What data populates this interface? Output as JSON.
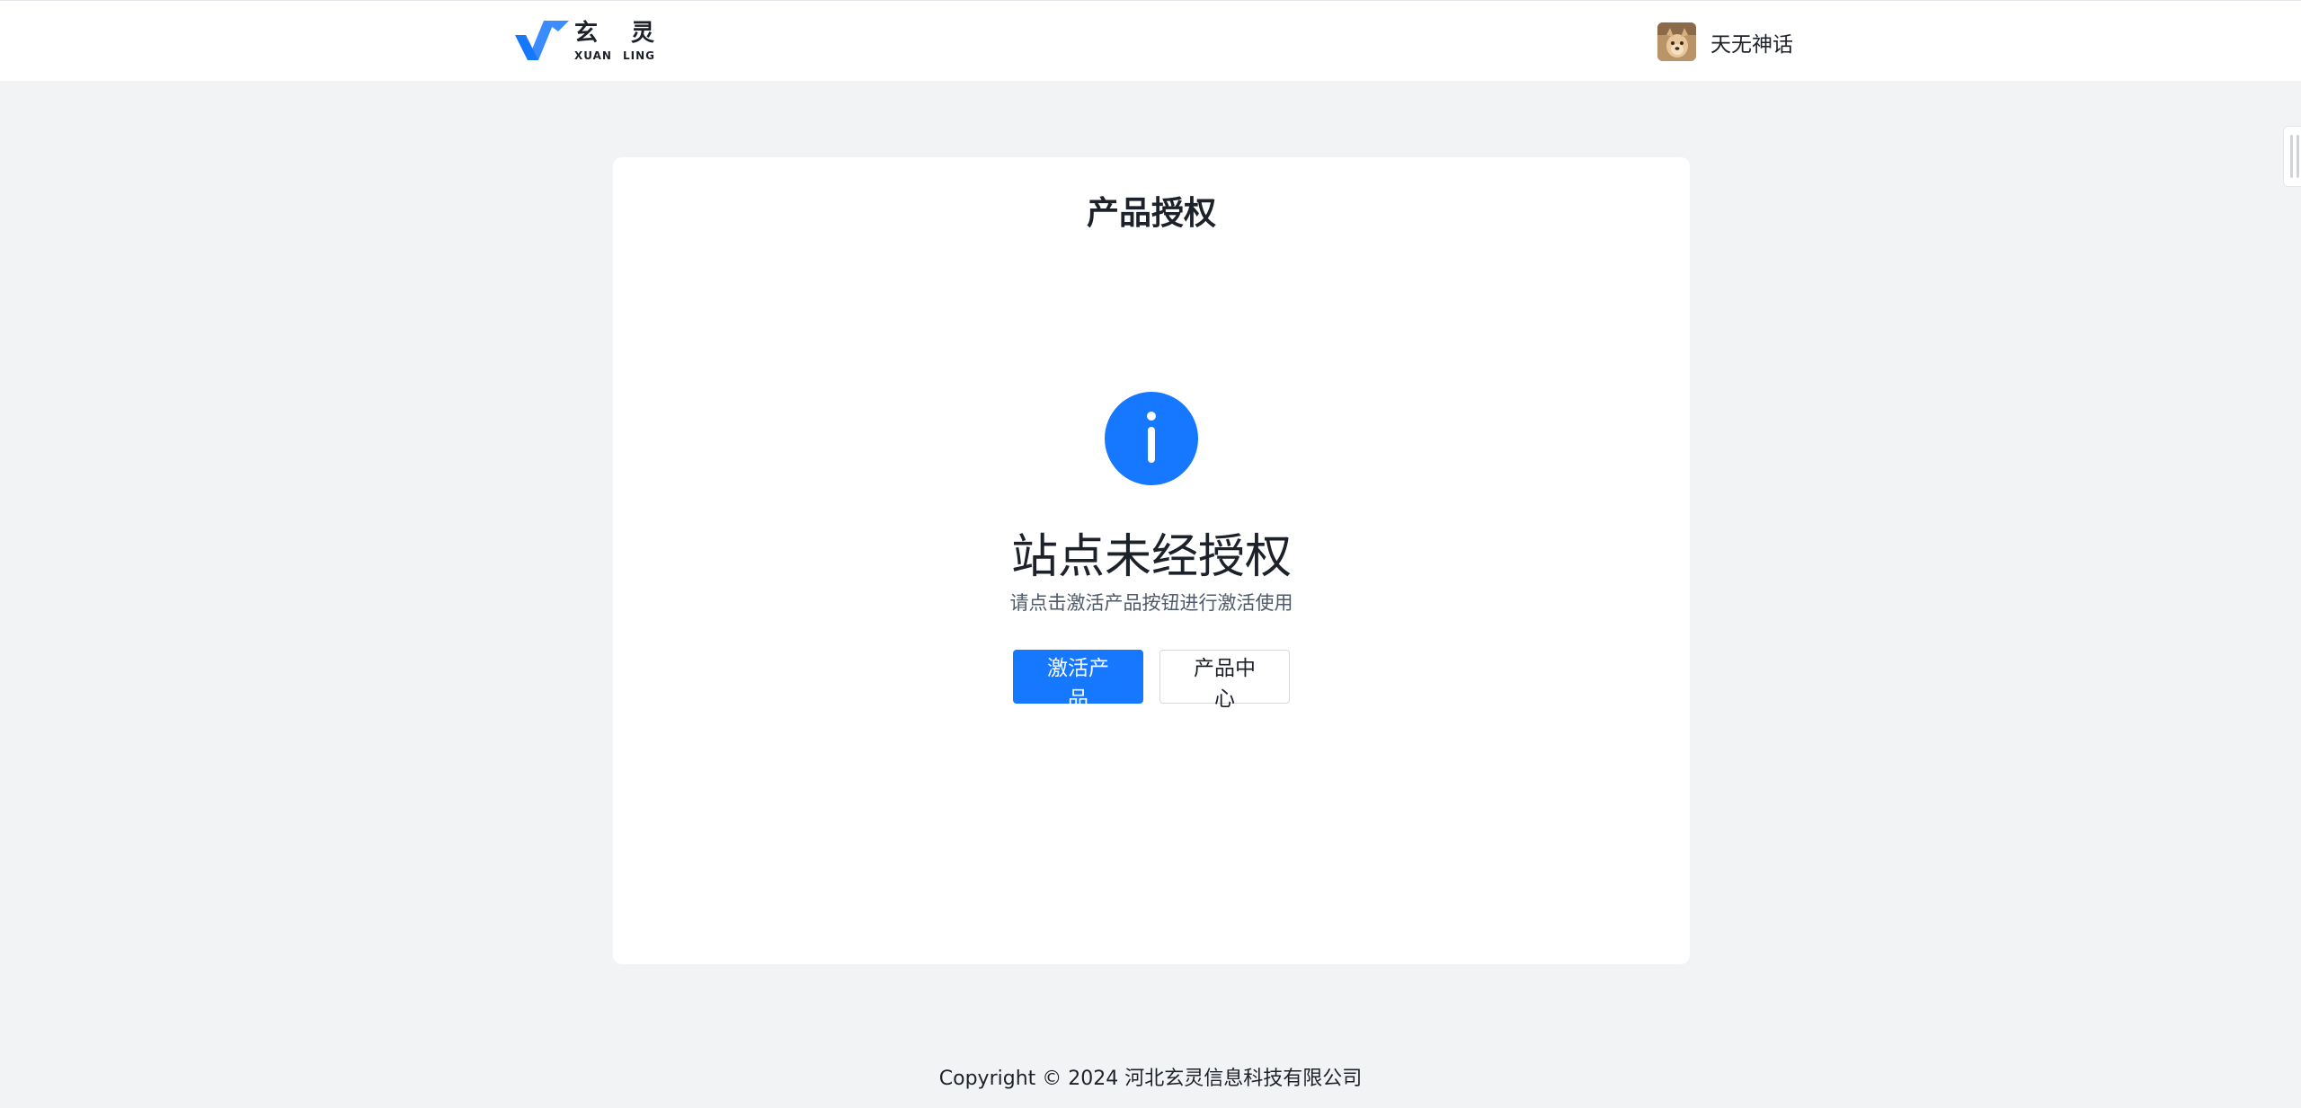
{
  "header": {
    "logo": {
      "cn": "玄 灵",
      "en_left": "XUAN",
      "en_right": "LING",
      "icon": "logo-v-mark"
    },
    "user": {
      "name": "天无神话",
      "avatar": "user-avatar-image"
    }
  },
  "card": {
    "title": "产品授权",
    "status_icon": "info-icon",
    "status_title": "站点未经授权",
    "status_subtitle": "请点击激活产品按钮进行激活使用",
    "buttons": {
      "activate": "激活产品",
      "product_center": "产品中心"
    }
  },
  "footer": {
    "copyright": "Copyright © 2024 河北玄灵信息科技有限公司"
  },
  "colors": {
    "primary": "#1677ff",
    "page_bg": "#f2f3f5",
    "card_bg": "#ffffff",
    "text": "#1d2129",
    "text_secondary": "#4e5969"
  }
}
